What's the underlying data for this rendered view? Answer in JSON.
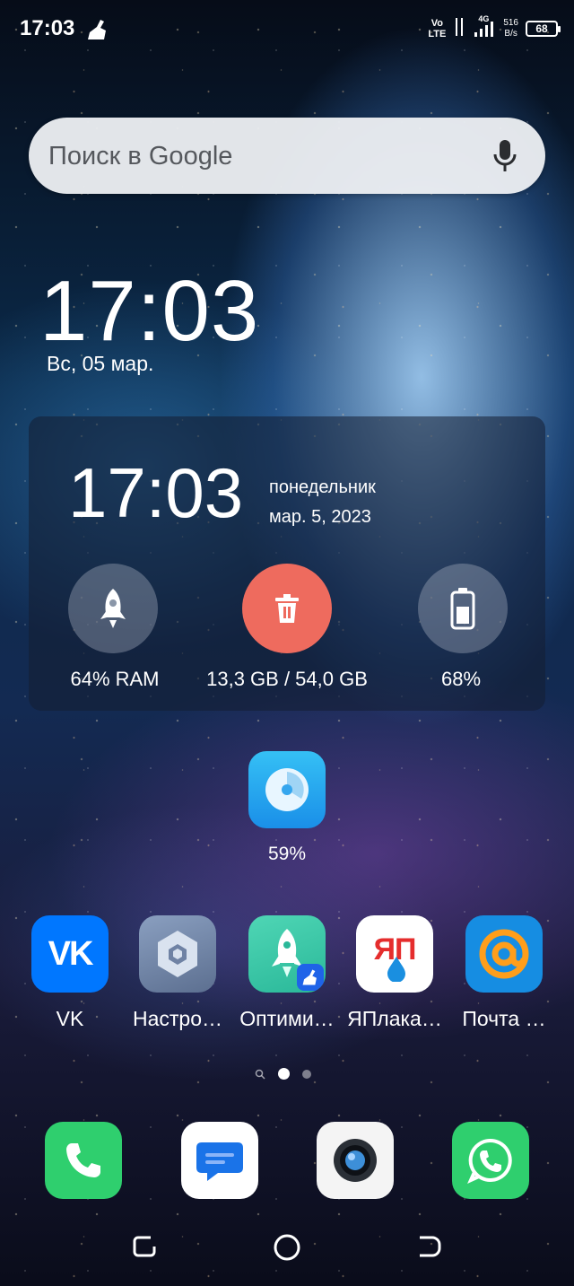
{
  "status_bar": {
    "time": "17:03",
    "volte_top": "Vo",
    "volte_bottom": "LTE",
    "network": "4G",
    "speed_value": "516",
    "speed_unit": "B/s",
    "battery": "68"
  },
  "search": {
    "placeholder": "Поиск в Google"
  },
  "clock": {
    "time": "17:03",
    "date": "Вс, 05 мар."
  },
  "widget": {
    "time": "17:03",
    "weekday": "понедельник",
    "date": "мар. 5, 2023",
    "ram_label": "64% RAM",
    "storage_label": "13,3 GB / 54,0 GB",
    "battery_label": "68%"
  },
  "speed_widget": {
    "label": "59%"
  },
  "apps": [
    {
      "label": "VK",
      "icon": "vk-icon"
    },
    {
      "label": "Настро…",
      "icon": "settings-icon"
    },
    {
      "label": "Оптими…",
      "icon": "optimizer-icon"
    },
    {
      "label": "ЯПлака…",
      "icon": "yaplakal-icon",
      "icon_text": "ЯП"
    },
    {
      "label": "Почта …",
      "icon": "mail-icon"
    }
  ],
  "dock": [
    {
      "name": "phone",
      "icon": "phone-icon"
    },
    {
      "name": "messages",
      "icon": "messages-icon"
    },
    {
      "name": "camera",
      "icon": "camera-icon"
    },
    {
      "name": "whatsapp",
      "icon": "whatsapp-icon"
    }
  ],
  "colors": {
    "vk": "#0077ff",
    "trash": "#ee6b5e",
    "dock_green": "#2fcf6e",
    "mail": "#168de2"
  }
}
